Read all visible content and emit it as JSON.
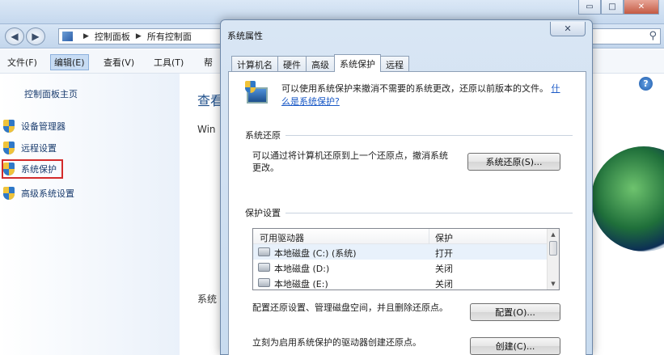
{
  "control_panel": {
    "window_controls": {
      "minimize": "▭",
      "maximize": "□",
      "close": "✕"
    },
    "nav": {
      "back": "◀",
      "forward": "▶"
    },
    "breadcrumb": [
      "控制面板",
      "所有控制面"
    ],
    "menu": [
      "文件(F)",
      "编辑(E)",
      "查看(V)",
      "工具(T)",
      "帮"
    ],
    "sidebar": {
      "title": "控制面板主页",
      "items": [
        "设备管理器",
        "远程设置",
        "系统保护",
        "高级系统设置"
      ]
    },
    "main": {
      "heading": "查看",
      "lines": [
        "Win",
        "系统"
      ]
    },
    "help": "?"
  },
  "dialog": {
    "title": "系统属性",
    "close": "✕",
    "tabs": [
      "计算机名",
      "硬件",
      "高级",
      "系统保护",
      "远程"
    ],
    "active_tab": "系统保护",
    "intro_text": "可以使用系统保护来撤消不需要的系统更改，还原以前版本的文件。",
    "intro_link": "什么是系统保护?",
    "restore": {
      "section": "系统还原",
      "text": "可以通过将计算机还原到上一个还原点，撤消系统更改。",
      "button": "系统还原(S)..."
    },
    "protection": {
      "section": "保护设置",
      "columns": [
        "可用驱动器",
        "保护"
      ],
      "drives": [
        {
          "name": "本地磁盘 (C:) (系统)",
          "protection": "打开"
        },
        {
          "name": "本地磁盘 (D:)",
          "protection": "关闭"
        },
        {
          "name": "本地磁盘 (E:)",
          "protection": "关闭"
        }
      ],
      "config_text": "配置还原设置、管理磁盘空间，并且删除还原点。",
      "config_button": "配置(O)...",
      "create_text": "立刻为启用系统保护的驱动器创建还原点。",
      "create_button": "创建(C)..."
    }
  },
  "colors": {
    "highlight_box": "#d32b2b",
    "link": "#1a59c6",
    "sidebar_text": "#1a3c6e"
  }
}
